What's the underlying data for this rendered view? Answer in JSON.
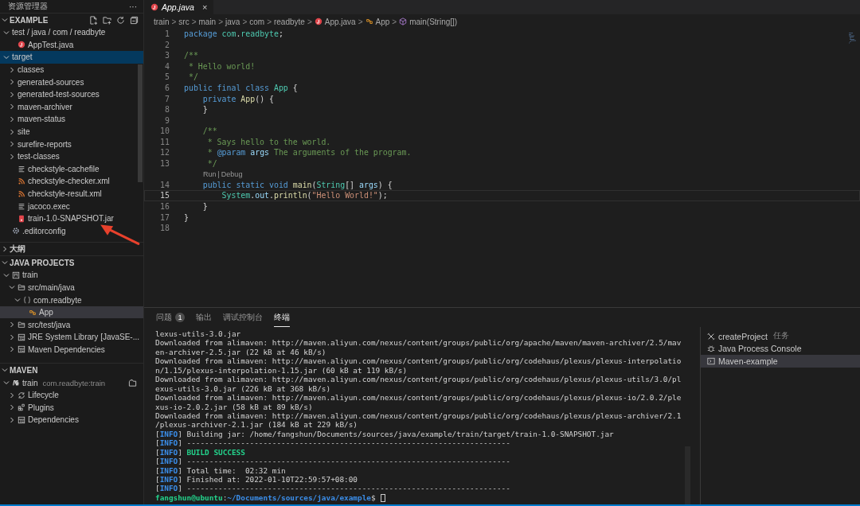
{
  "sidebar": {
    "title": "资源管理器",
    "more": "···",
    "sections": [
      {
        "title": "EXAMPLE",
        "expanded": true,
        "kind": "explorer",
        "items": [
          {
            "label": "test / java / com / readbyte",
            "kind": "folder",
            "expanded": true,
            "selected": false,
            "children": [
              {
                "label": "AppTest.java",
                "kind": "java",
                "selected": false
              }
            ]
          },
          {
            "label": "target",
            "kind": "folder",
            "expanded": true,
            "selected": true,
            "children": [
              {
                "label": "classes",
                "kind": "folder",
                "expanded": false,
                "selected": false
              },
              {
                "label": "generated-sources",
                "kind": "folder",
                "expanded": false,
                "selected": false
              },
              {
                "label": "generated-test-sources",
                "kind": "folder",
                "expanded": false,
                "selected": false
              },
              {
                "label": "maven-archiver",
                "kind": "folder",
                "expanded": false,
                "selected": false
              },
              {
                "label": "maven-status",
                "kind": "folder",
                "expanded": false,
                "selected": false
              },
              {
                "label": "site",
                "kind": "folder",
                "expanded": false,
                "selected": false
              },
              {
                "label": "surefire-reports",
                "kind": "folder",
                "expanded": false,
                "selected": false
              },
              {
                "label": "test-classes",
                "kind": "folder",
                "expanded": false,
                "selected": false
              },
              {
                "label": "checkstyle-cachefile",
                "kind": "text",
                "selected": false
              },
              {
                "label": "checkstyle-checker.xml",
                "kind": "xml",
                "selected": false
              },
              {
                "label": "checkstyle-result.xml",
                "kind": "xml",
                "selected": false
              },
              {
                "label": "jacoco.exec",
                "kind": "text",
                "selected": false
              },
              {
                "label": "train-1.0-SNAPSHOT.jar",
                "kind": "jar",
                "selected": false
              }
            ]
          },
          {
            "label": ".editorconfig",
            "kind": "gear",
            "selected": false
          }
        ]
      },
      {
        "title": "大纲",
        "expanded": false,
        "kind": "outline"
      },
      {
        "title": "JAVA PROJECTS",
        "expanded": true,
        "kind": "projects",
        "items": [
          {
            "label": "train",
            "kind": "project",
            "expanded": true,
            "selected": false,
            "children": [
              {
                "label": "src/main/java",
                "kind": "package-root",
                "expanded": true,
                "selected": false,
                "children": [
                  {
                    "label": "com.readbyte",
                    "kind": "package",
                    "expanded": true,
                    "selected": false,
                    "children": [
                      {
                        "label": "App",
                        "kind": "class",
                        "selected": true
                      }
                    ]
                  }
                ]
              },
              {
                "label": "src/test/java",
                "kind": "package-root",
                "expanded": false,
                "selected": false
              },
              {
                "label": "JRE System Library [JavaSE-...",
                "kind": "library",
                "expanded": false,
                "selected": false
              },
              {
                "label": "Maven Dependencies",
                "kind": "library",
                "expanded": false,
                "selected": false
              }
            ]
          }
        ]
      },
      {
        "title": "MAVEN",
        "expanded": true,
        "kind": "maven",
        "items": [
          {
            "label": "train",
            "description": "com.readbyte:train",
            "kind": "maven-project",
            "expanded": true,
            "selected": false,
            "children": [
              {
                "label": "Lifecycle",
                "kind": "lifecycle",
                "expanded": false,
                "selected": false
              },
              {
                "label": "Plugins",
                "kind": "plugins",
                "expanded": false,
                "selected": false
              },
              {
                "label": "Dependencies",
                "kind": "library",
                "expanded": false,
                "selected": false
              }
            ]
          }
        ]
      }
    ]
  },
  "annotation": {
    "kind": "arrow"
  },
  "editor": {
    "tabs": [
      {
        "label": "App.java",
        "close": "×",
        "selected": true
      }
    ],
    "breadcrumbs": [
      {
        "label": "train"
      },
      {
        "label": "src"
      },
      {
        "label": "main"
      },
      {
        "label": "java"
      },
      {
        "label": "com"
      },
      {
        "label": "readbyte"
      },
      {
        "label": "App.java",
        "kind": "java"
      },
      {
        "label": "App",
        "kind": "class"
      },
      {
        "label": "main(String[])",
        "kind": "method"
      }
    ],
    "breadcrumb_separator": ">",
    "lines": [
      {
        "number": "1",
        "current": false,
        "tokens": [
          {
            "t": "package ",
            "kind": "kw"
          },
          {
            "t": "com",
            "kind": "type"
          },
          {
            "t": ".",
            "kind": "plain"
          },
          {
            "t": "readbyte",
            "kind": "type"
          },
          {
            "t": ";",
            "kind": "plain"
          }
        ]
      },
      {
        "number": "2",
        "current": false
      },
      {
        "number": "3",
        "current": false,
        "tokens": [
          {
            "t": "/**",
            "kind": "cmt"
          }
        ]
      },
      {
        "number": "4",
        "current": false,
        "tokens": [
          {
            "t": " * Hello world!",
            "kind": "cmt"
          }
        ]
      },
      {
        "number": "5",
        "current": false,
        "tokens": [
          {
            "t": " */",
            "kind": "cmt"
          }
        ]
      },
      {
        "number": "6",
        "current": false,
        "tokens": [
          {
            "t": "public final class ",
            "kind": "kw"
          },
          {
            "t": "App",
            "kind": "type"
          },
          {
            "t": " {",
            "kind": "plain"
          }
        ]
      },
      {
        "number": "7",
        "current": false,
        "tokens": [
          {
            "t": "    private ",
            "kind": "kw"
          },
          {
            "t": "App",
            "kind": "fn"
          },
          {
            "t": "() {",
            "kind": "plain"
          }
        ]
      },
      {
        "number": "8",
        "current": false,
        "tokens": [
          {
            "t": "    }",
            "kind": "plain"
          }
        ]
      },
      {
        "number": "9",
        "current": false
      },
      {
        "number": "10",
        "current": false,
        "tokens": [
          {
            "t": "    /**",
            "kind": "cmt"
          }
        ]
      },
      {
        "number": "11",
        "current": false,
        "tokens": [
          {
            "t": "     * Says hello to the world.",
            "kind": "cmt"
          }
        ]
      },
      {
        "number": "12",
        "current": false,
        "tokens": [
          {
            "t": "     * ",
            "kind": "cmt"
          },
          {
            "t": "@param",
            "kind": "kw"
          },
          {
            "t": " args",
            "kind": "var"
          },
          {
            "t": " The arguments of the program.",
            "kind": "cmt"
          }
        ]
      },
      {
        "number": "13",
        "current": false,
        "tokens": [
          {
            "t": "     */",
            "kind": "cmt"
          }
        ]
      },
      {
        "kind": "codelens",
        "links": [
          "Run",
          "Debug"
        ],
        "separator": "|"
      },
      {
        "number": "14",
        "current": false,
        "tokens": [
          {
            "t": "    public static void ",
            "kind": "kw"
          },
          {
            "t": "main",
            "kind": "fn"
          },
          {
            "t": "(",
            "kind": "plain"
          },
          {
            "t": "String",
            "kind": "type"
          },
          {
            "t": "[] ",
            "kind": "plain"
          },
          {
            "t": "args",
            "kind": "var"
          },
          {
            "t": ") {",
            "kind": "plain"
          }
        ]
      },
      {
        "number": "15",
        "current": true,
        "tokens": [
          {
            "t": "        System",
            "kind": "type"
          },
          {
            "t": ".",
            "kind": "plain"
          },
          {
            "t": "out",
            "kind": "var"
          },
          {
            "t": ".",
            "kind": "plain"
          },
          {
            "t": "println",
            "kind": "fn"
          },
          {
            "t": "(",
            "kind": "plain"
          },
          {
            "t": "\"Hello World!\"",
            "kind": "str"
          },
          {
            "t": ");",
            "kind": "plain"
          }
        ]
      },
      {
        "number": "16",
        "current": false,
        "tokens": [
          {
            "t": "    }",
            "kind": "plain"
          }
        ]
      },
      {
        "number": "17",
        "current": false,
        "tokens": [
          {
            "t": "}",
            "kind": "plain"
          }
        ]
      },
      {
        "number": "18",
        "current": false
      }
    ]
  },
  "panel": {
    "tabs": [
      {
        "label": "问题",
        "badge": "1",
        "selected": false
      },
      {
        "label": "输出",
        "selected": false
      },
      {
        "label": "调试控制台",
        "selected": false
      },
      {
        "label": "终端",
        "selected": true
      }
    ],
    "terminal_lines": [
      {
        "tokens": [
          {
            "t": "lexus-utils-3.0.jar",
            "kind": "plain"
          }
        ]
      },
      {
        "tokens": [
          {
            "t": "Downloaded from alimaven: http://maven.aliyun.com/nexus/content/groups/public/org/apache/maven/maven-archiver/2.5/mav",
            "kind": "plain"
          }
        ]
      },
      {
        "tokens": [
          {
            "t": "en-archiver-2.5.jar (22 kB at 46 kB/s)",
            "kind": "plain"
          }
        ]
      },
      {
        "tokens": [
          {
            "t": "Downloaded from alimaven: http://maven.aliyun.com/nexus/content/groups/public/org/codehaus/plexus/plexus-interpolatio",
            "kind": "plain"
          }
        ]
      },
      {
        "tokens": [
          {
            "t": "n/1.15/plexus-interpolation-1.15.jar (60 kB at 119 kB/s)",
            "kind": "plain"
          }
        ]
      },
      {
        "tokens": [
          {
            "t": "Downloaded from alimaven: http://maven.aliyun.com/nexus/content/groups/public/org/codehaus/plexus/plexus-utils/3.0/pl",
            "kind": "plain"
          }
        ]
      },
      {
        "tokens": [
          {
            "t": "exus-utils-3.0.jar (226 kB at 368 kB/s)",
            "kind": "plain"
          }
        ]
      },
      {
        "tokens": [
          {
            "t": "Downloaded from alimaven: http://maven.aliyun.com/nexus/content/groups/public/org/codehaus/plexus/plexus-io/2.0.2/ple",
            "kind": "plain"
          }
        ]
      },
      {
        "tokens": [
          {
            "t": "xus-io-2.0.2.jar (58 kB at 89 kB/s)",
            "kind": "plain"
          }
        ]
      },
      {
        "tokens": [
          {
            "t": "Downloaded from alimaven: http://maven.aliyun.com/nexus/content/groups/public/org/codehaus/plexus/plexus-archiver/2.1",
            "kind": "plain"
          }
        ]
      },
      {
        "tokens": [
          {
            "t": "/plexus-archiver-2.1.jar (184 kB at 229 kB/s)",
            "kind": "plain"
          }
        ]
      },
      {
        "tokens": [
          {
            "t": "[",
            "kind": "plain"
          },
          {
            "t": "INFO",
            "kind": "info"
          },
          {
            "t": "] Building jar: /home/fangshun/Documents/sources/java/example/train/target/train-1.0-SNAPSHOT.jar",
            "kind": "plain"
          }
        ]
      },
      {
        "tokens": [
          {
            "t": "[",
            "kind": "plain"
          },
          {
            "t": "INFO",
            "kind": "info"
          },
          {
            "t": "] ------------------------------------------------------------------------",
            "kind": "plain"
          }
        ]
      },
      {
        "tokens": [
          {
            "t": "[",
            "kind": "plain"
          },
          {
            "t": "INFO",
            "kind": "info"
          },
          {
            "t": "]",
            "kind": "plain"
          },
          {
            "t": " BUILD SUCCESS",
            "kind": "success"
          }
        ]
      },
      {
        "tokens": [
          {
            "t": "[",
            "kind": "plain"
          },
          {
            "t": "INFO",
            "kind": "info"
          },
          {
            "t": "] ------------------------------------------------------------------------",
            "kind": "plain"
          }
        ]
      },
      {
        "tokens": [
          {
            "t": "[",
            "kind": "plain"
          },
          {
            "t": "INFO",
            "kind": "info"
          },
          {
            "t": "] Total time:  02:32 min",
            "kind": "plain"
          }
        ]
      },
      {
        "tokens": [
          {
            "t": "[",
            "kind": "plain"
          },
          {
            "t": "INFO",
            "kind": "info"
          },
          {
            "t": "] Finished at: 2022-01-10T22:59:57+08:00",
            "kind": "plain"
          }
        ]
      },
      {
        "tokens": [
          {
            "t": "[",
            "kind": "plain"
          },
          {
            "t": "INFO",
            "kind": "info"
          },
          {
            "t": "] ------------------------------------------------------------------------",
            "kind": "plain"
          }
        ]
      },
      {
        "tokens": [
          {
            "t": "fangshun@ubuntu",
            "kind": "user"
          },
          {
            "t": ":",
            "kind": "plain"
          },
          {
            "t": "~/Documents/sources/java/example",
            "kind": "path"
          },
          {
            "t": "$",
            "kind": "plain"
          }
        ],
        "cursor": true
      }
    ],
    "terminals": [
      {
        "label": "createProject",
        "description": "任务",
        "kind": "tools",
        "selected": false
      },
      {
        "label": "Java Process Console",
        "kind": "bug",
        "selected": false
      },
      {
        "label": "Maven-example",
        "kind": "terminal",
        "selected": true
      }
    ]
  }
}
